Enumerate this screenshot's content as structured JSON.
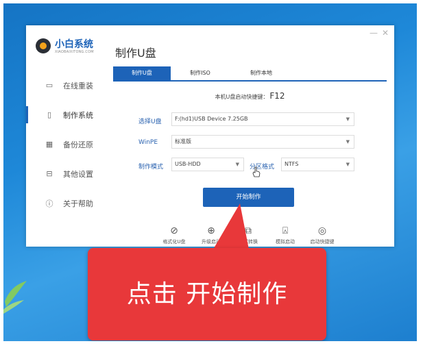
{
  "app": {
    "brand_name": "小白系统",
    "brand_sub": "XIAOBAIXITONG.COM",
    "page_title": "制作U盘",
    "window_controls": {
      "minimize": "—",
      "close": "✕"
    }
  },
  "sidebar": {
    "items": [
      {
        "label": "在线重装",
        "icon": "monitor-icon",
        "active": false
      },
      {
        "label": "制作系统",
        "icon": "usb-icon",
        "active": true
      },
      {
        "label": "备份还原",
        "icon": "backup-icon",
        "active": false
      },
      {
        "label": "其他设置",
        "icon": "toolbox-icon",
        "active": false
      },
      {
        "label": "关于帮助",
        "icon": "info-icon",
        "active": false
      }
    ]
  },
  "tabs": [
    {
      "label": "制作U盘",
      "active": true
    },
    {
      "label": "制作ISO",
      "active": false
    },
    {
      "label": "制作本地",
      "active": false
    }
  ],
  "hotkey": {
    "label": "本机U盘启动快捷键：",
    "key": "F12"
  },
  "form": {
    "usb_label": "选择U盘",
    "usb_value": "F:(hd1)USB Device 7.25GB",
    "winpe_label": "WinPE",
    "winpe_value": "标准版",
    "mode_label": "制作模式",
    "mode_value": "USB-HDD",
    "partition_label": "分区格式",
    "partition_value": "NTFS"
  },
  "start_button": "开始制作",
  "tools": [
    {
      "label": "格式化U盘",
      "icon": "format-icon"
    },
    {
      "label": "升级启动",
      "icon": "upgrade-icon"
    },
    {
      "label": "格式转换",
      "icon": "convert-icon"
    },
    {
      "label": "模拟启动",
      "icon": "simulate-icon"
    },
    {
      "label": "启动快捷键",
      "icon": "mouse-icon"
    }
  ],
  "callout": {
    "text": "点击 开始制作"
  },
  "colors": {
    "accent": "#1d63b8",
    "callout": "#e8383a",
    "desktop": "#1e88d8"
  }
}
